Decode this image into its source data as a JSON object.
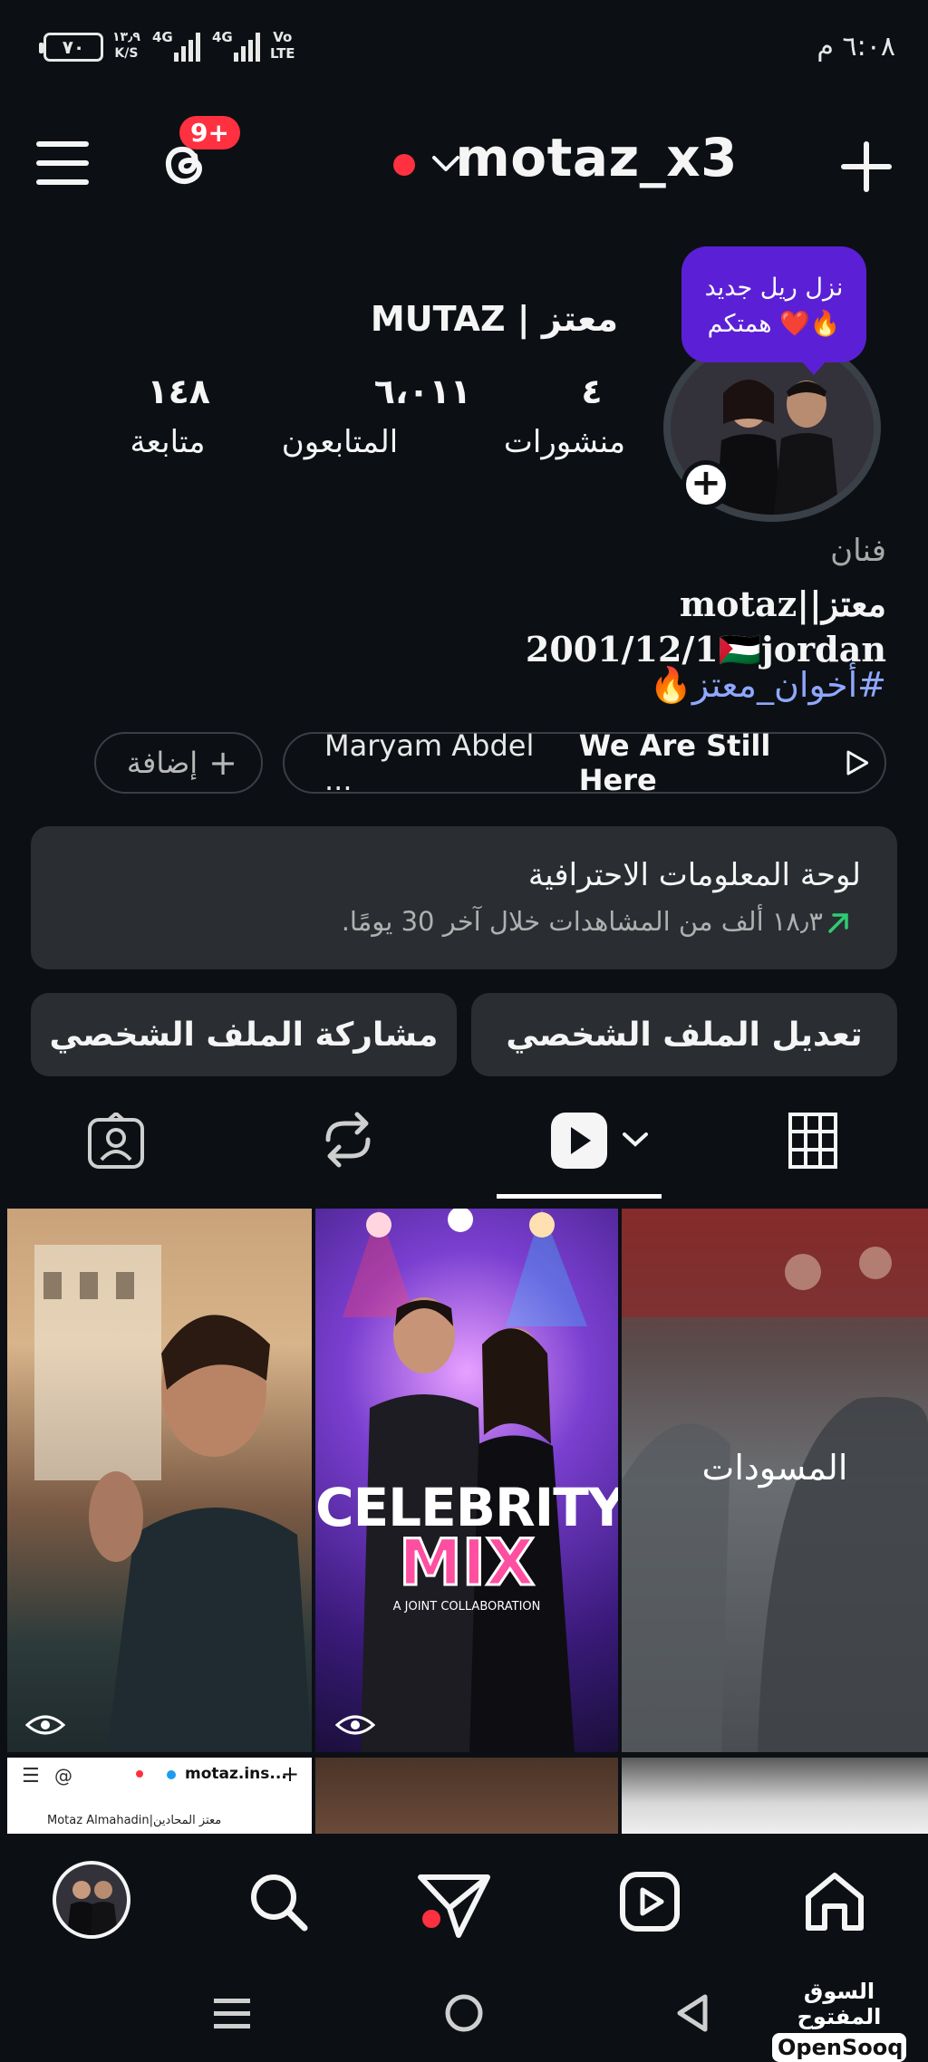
{
  "status_bar": {
    "time": "٦:٠٨ م",
    "battery": "٧٠",
    "net_speed_value": "١٣٫٩",
    "net_speed_unit": "K/S",
    "signal1": "4G",
    "signal2": "4G",
    "volte_top": "Vo",
    "volte_bottom": "LTE"
  },
  "header": {
    "username": "motaz_x3",
    "notification_badge": "9+"
  },
  "profile": {
    "display_name": "MUTAZ | معتز",
    "bubble_line1": "نزل ريل جديد",
    "bubble_line2": "همتكم ❤️🔥",
    "stats": [
      {
        "value": "٤",
        "label": "منشورات"
      },
      {
        "value": "٦،٠١١",
        "label": "المتابعون"
      },
      {
        "value": "١٤٨",
        "label": "متابعة"
      }
    ],
    "category": "فنان",
    "bio_line1": "motaz||معتز",
    "bio_line2": "2001/12/1🇵🇸jordan",
    "bio_hashtag": "#أخوان_معتز🔥"
  },
  "highlights": {
    "music_artist": "Maryam Abdel ...",
    "music_title": "We Are Still Here",
    "add_label": "إضافة"
  },
  "dashboard": {
    "title": "لوحة المعلومات الاحترافية",
    "subtitle": "١٨٫٣ ألف من المشاهدات خلال آخر 30 يومًا."
  },
  "buttons": {
    "edit_profile": "تعديل الملف الشخصي",
    "share_profile": "مشاركة الملف الشخصي"
  },
  "grid": {
    "drafts_label": "المسودات",
    "celebrity_title": "CELEBRITY",
    "celebrity_mix": "MIX",
    "celebrity_sub": "A JOINT COLLABORATION",
    "small_tile_username": "motaz.ins...",
    "small_tile_name": "Motaz Almahadin|معتز المحادين"
  },
  "colors": {
    "background": "#0c1014",
    "card": "#2a2e33",
    "badge_red": "#ff3040",
    "bubble_purple": "#5b20d6",
    "hashtag_blue": "#8fa8ff",
    "trend_green": "#2ecc71"
  },
  "watermark": {
    "arabic": "السوق المفتوح",
    "latin": "OpenSooq"
  }
}
